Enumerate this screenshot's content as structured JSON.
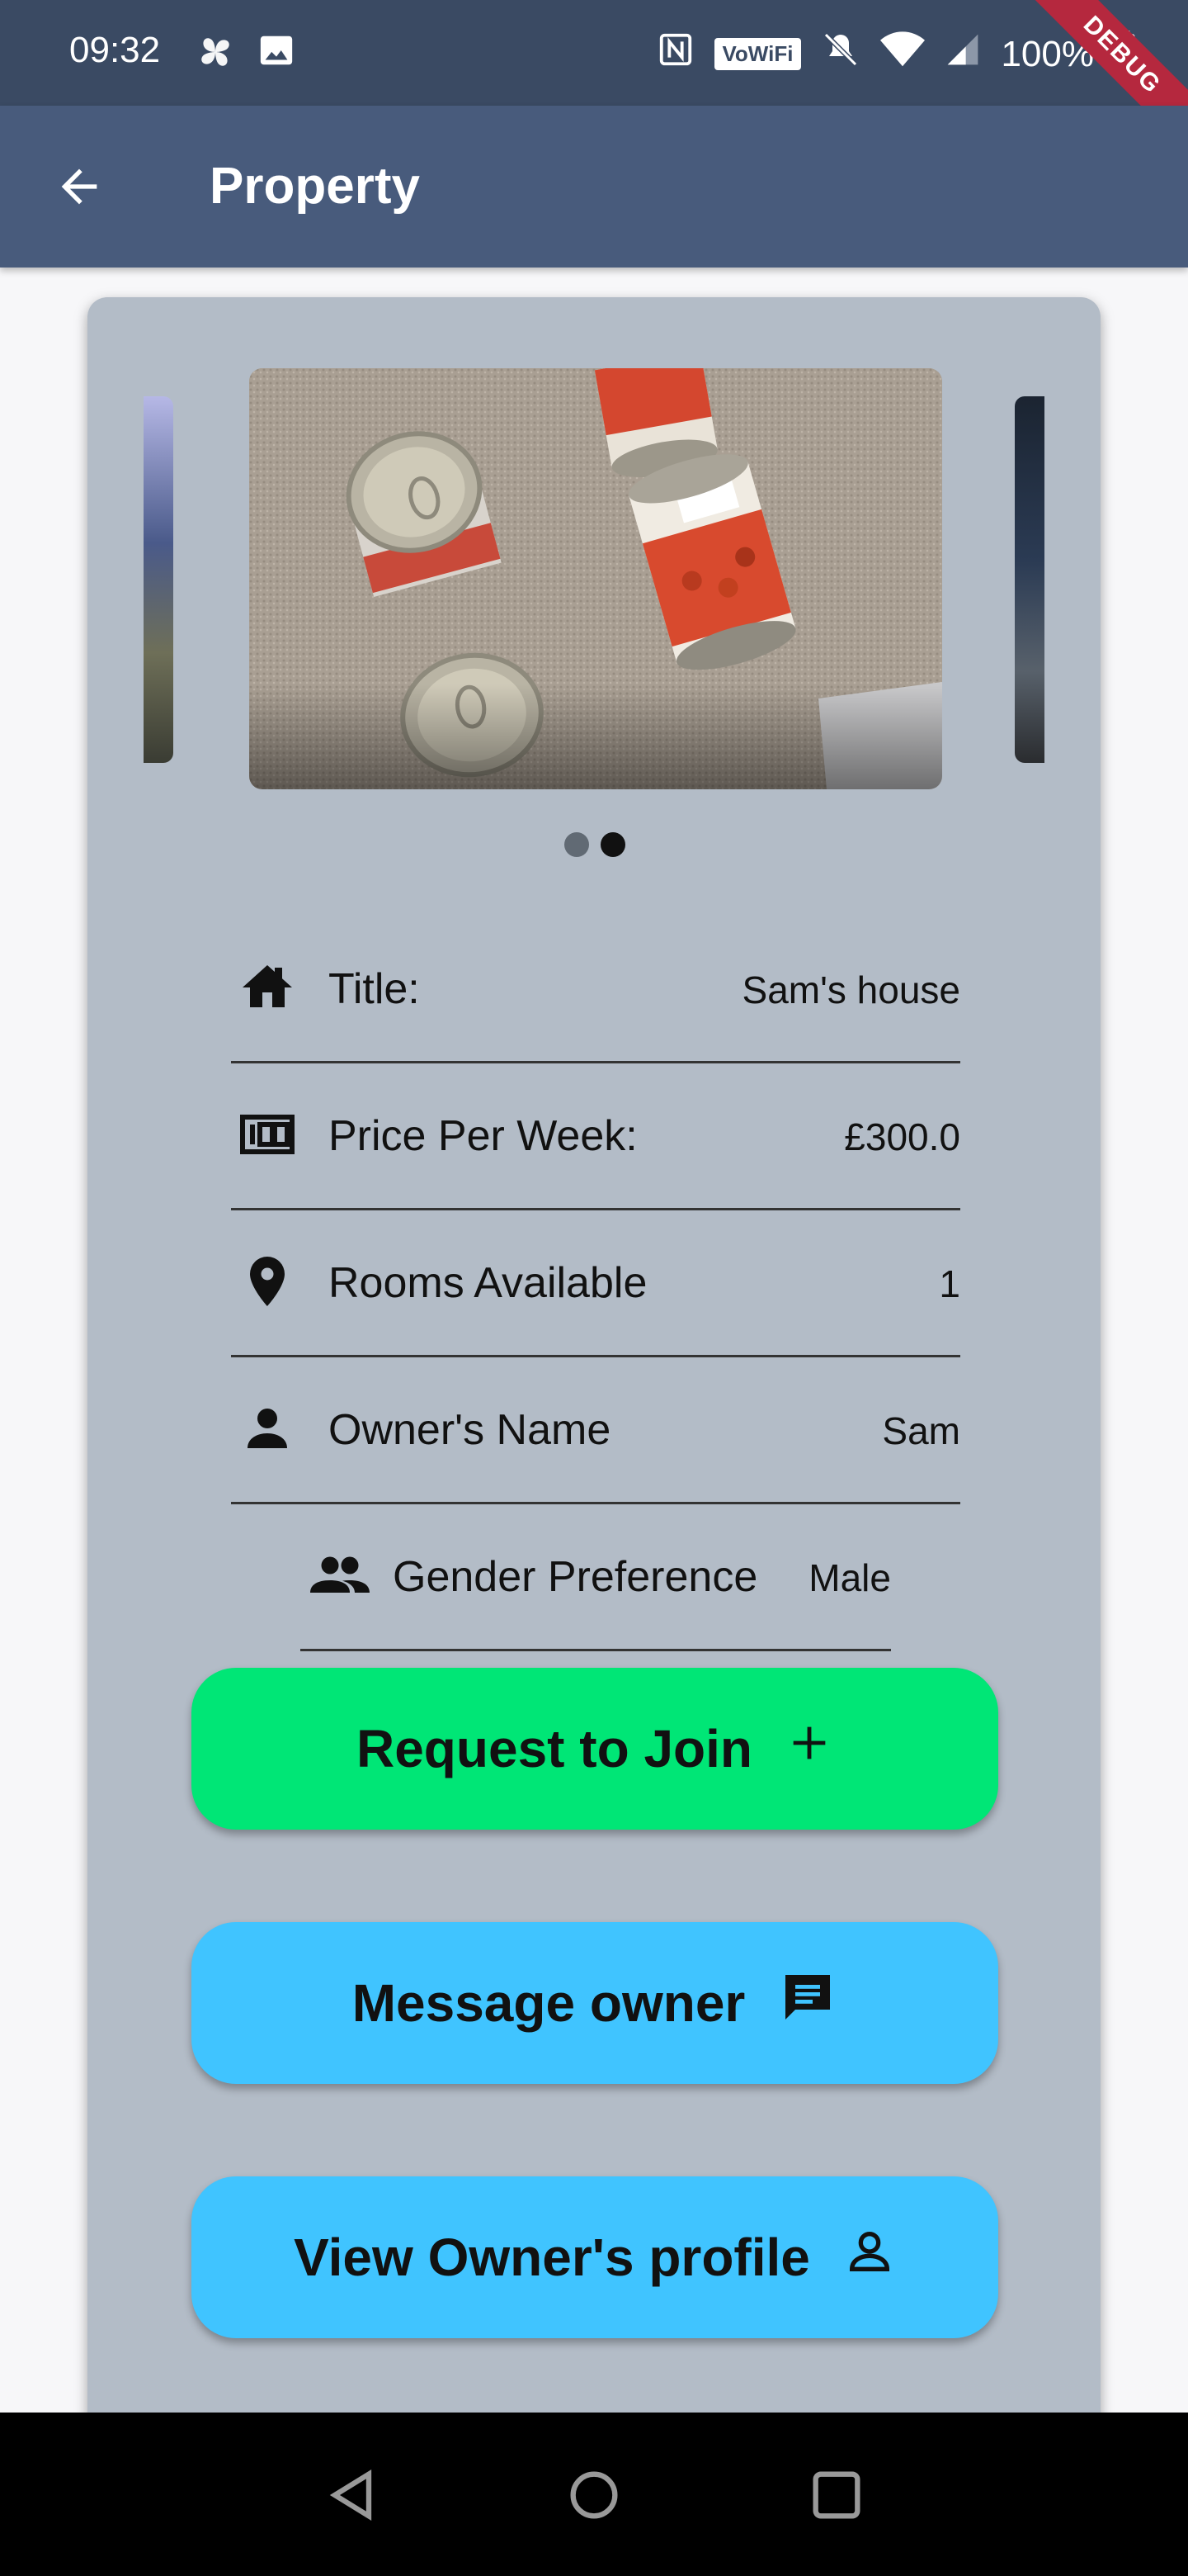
{
  "status_bar": {
    "time": "09:32",
    "battery": "100%",
    "wifi_label": "VoWiFi",
    "debug_label": "DEBUG"
  },
  "app_bar": {
    "title": "Property"
  },
  "carousel": {
    "image_description_icon": "photo-carousel",
    "active_dot": 1,
    "dot_count": 2
  },
  "details": [
    {
      "icon": "house-icon",
      "label": "Title:",
      "value": "Sam's house"
    },
    {
      "icon": "money-icon",
      "label": "Price Per Week:",
      "value": "£300.0"
    },
    {
      "icon": "location-pin-icon",
      "label": "Rooms Available",
      "value": "1"
    },
    {
      "icon": "person-icon",
      "label": "Owner's Name",
      "value": "Sam"
    },
    {
      "icon": "people-icon",
      "label": "Gender Preference",
      "value": "Male"
    }
  ],
  "buttons": {
    "request_join": "Request to Join",
    "message_owner": "Message owner",
    "view_profile": "View Owner's profile"
  },
  "colors": {
    "status_bar": "#3a4a63",
    "app_bar": "#485b7c",
    "card": "#b3bcc7",
    "green_button": "#00e676",
    "blue_button": "#40c4ff"
  }
}
